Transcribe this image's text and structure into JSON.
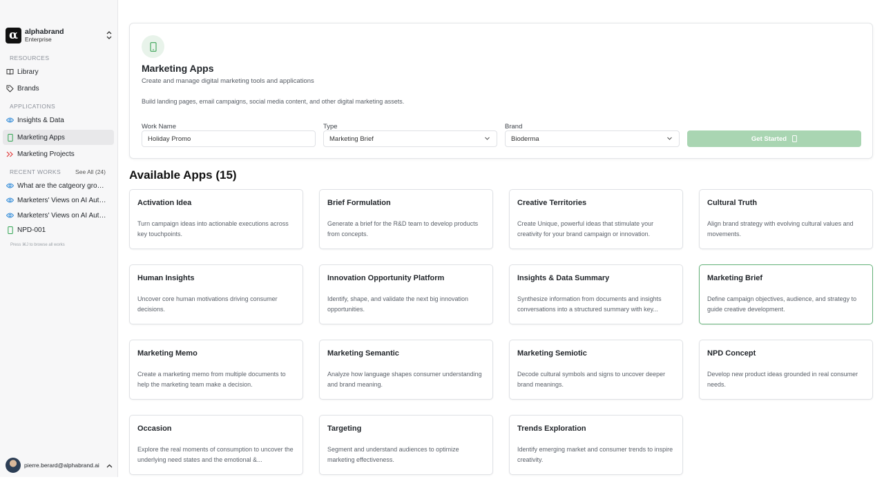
{
  "sidebar": {
    "org_logo": "α",
    "org_name": "alphabrand",
    "org_plan": "Enterprise",
    "resources_label": "RESOURCES",
    "resources": [
      {
        "label": "Library",
        "icon": "book-icon"
      },
      {
        "label": "Brands",
        "icon": "tag-icon"
      }
    ],
    "applications_label": "APPLICATIONS",
    "applications": [
      {
        "label": "Insights & Data",
        "icon": "eye-icon"
      },
      {
        "label": "Marketing Apps",
        "icon": "phone-icon"
      },
      {
        "label": "Marketing Projects",
        "icon": "double-chevron-icon"
      }
    ],
    "recent_label": "RECENT WORKS",
    "see_all": "See All (24)",
    "recent": [
      {
        "label": "What are the catgeory growin...",
        "icon": "eye-icon"
      },
      {
        "label": "Marketers' Views on AI Auto...",
        "icon": "eye-icon"
      },
      {
        "label": "Marketers' Views on AI Auto...",
        "icon": "eye-icon"
      },
      {
        "label": "NPD-001",
        "icon": "phone-icon"
      }
    ],
    "hint": "Press ⌘J to browse all works",
    "user_email": "pierre.berard@alphabrand.ai"
  },
  "hero": {
    "title": "Marketing Apps",
    "subtitle": "Create and manage digital marketing tools and applications",
    "description": "Build landing pages, email campaigns, social media content, and other digital marketing assets.",
    "work_name_label": "Work Name",
    "work_name_value": "Holiday Promo",
    "type_label": "Type",
    "type_value": "Marketing Brief",
    "brand_label": "Brand",
    "brand_value": "Bioderma",
    "start_button": "Get Started"
  },
  "apps_title": "Available Apps (15)",
  "apps": [
    {
      "name": "Activation Idea",
      "desc": "Turn campaign ideas into actionable executions across key touchpoints."
    },
    {
      "name": "Brief Formulation",
      "desc": "Generate a brief for the R&D team to develop products from concepts."
    },
    {
      "name": "Creative Territories",
      "desc": "Create Unique, powerful ideas that stimulate your creativity for your brand campaign or innovation."
    },
    {
      "name": "Cultural Truth",
      "desc": "Align brand strategy with evolving cultural values and movements."
    },
    {
      "name": "Human Insights",
      "desc": "Uncover core human motivations driving consumer decisions."
    },
    {
      "name": "Innovation Opportunity Platform",
      "desc": "Identify, shape, and validate the next big innovation opportunities."
    },
    {
      "name": "Insights & Data Summary",
      "desc": "Synthesize information from documents and insights conversations into a structured summary with key..."
    },
    {
      "name": "Marketing Brief",
      "desc": "Define campaign objectives, audience, and strategy to guide creative development."
    },
    {
      "name": "Marketing Memo",
      "desc": "Create a marketing memo from multiple documents to help the marketing team make a decision."
    },
    {
      "name": "Marketing Semantic",
      "desc": "Analyze how language shapes consumer understanding and brand meaning."
    },
    {
      "name": "Marketing Semiotic",
      "desc": "Decode cultural symbols and signs to uncover deeper brand meanings."
    },
    {
      "name": "NPD Concept",
      "desc": "Develop new product ideas grounded in real consumer needs."
    },
    {
      "name": "Occasion",
      "desc": "Explore the real moments of consumption to uncover the underlying need states and the emotional &..."
    },
    {
      "name": "Targeting",
      "desc": "Segment and understand audiences to optimize marketing effectiveness."
    },
    {
      "name": "Trends Exploration",
      "desc": "Identify emerging market and consumer trends to inspire creativity."
    }
  ],
  "colors": {
    "accent": "#62b077",
    "accent_light": "#a9d5b2",
    "selected_nav": "#e8e8ea"
  }
}
